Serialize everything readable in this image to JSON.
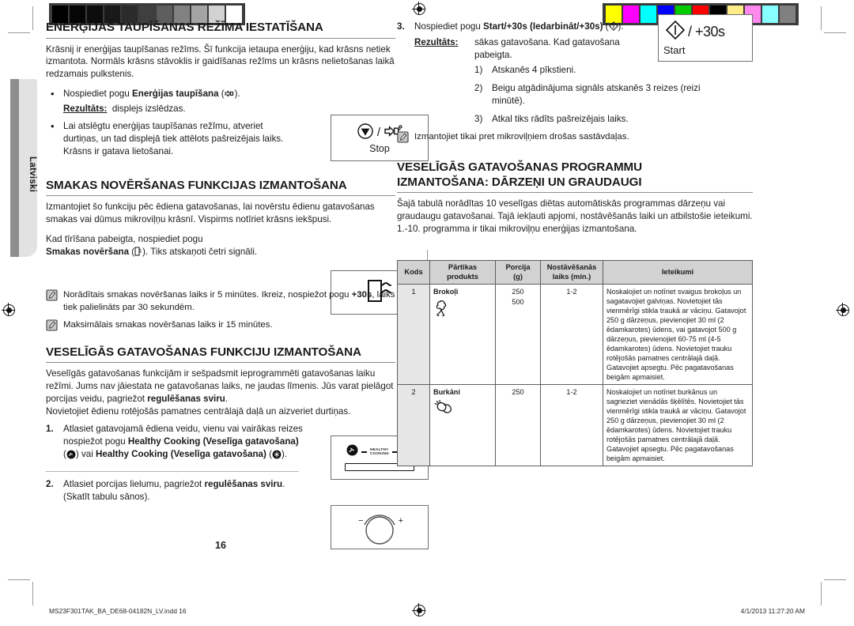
{
  "page": {
    "language_tab": "Latviski",
    "page_number": "16"
  },
  "calibration": {
    "gray_bar_name": "grayscale-calibration-bar",
    "gray_swatches": [
      "#000000",
      "#060606",
      "#0d0d0d",
      "#191919",
      "#2b2b2b",
      "#3f3f3f",
      "#5e5e5e",
      "#828282",
      "#a4a4a4",
      "#d2d2d2",
      "#ffffff"
    ],
    "color_bar_name": "color-calibration-bar",
    "color_swatches": [
      "#ffff00",
      "#ff00ff",
      "#00ffff",
      "#0000ff",
      "#00cc00",
      "#ff0000",
      "#000000",
      "#ffee88",
      "#ff88ee",
      "#88ffff",
      "#808080"
    ]
  },
  "left_column": {
    "section1": {
      "heading": "ENERĢIJAS TAUPĪŠANAS REŽĪMA IESTATĪŠANA",
      "intro": "Krāsnij ir enerģijas taupīšanas režīms. Šī funkcija ietaupa enerģiju, kad krāsns netiek izmantota. Normāls krāsns stāvoklis ir gaidīšanas režīms un krāsns nelietošanas laikā redzamais pulkstenis.",
      "bullet1_pre": "Nospiediet pogu ",
      "bullet1_bold": "Enerģijas taupīšana",
      "bullet1_post": " (",
      "bullet1_end": ").",
      "result_label": "Rezultāts:",
      "result_text": "displejs izslēdzas.",
      "bullet2": "Lai atslēgtu enerģijas taupīšanas režīmu, atveriet durtiņas, un tad displejā tiek attēlots pašreizējais laiks. Krāsns ir gatava lietošanai.",
      "illustration_label": "Stop"
    },
    "section2": {
      "heading": "SMAKAS NOVĒRŠANAS FUNKCIJAS IZMANTOŠANA",
      "intro": "Izmantojiet šo funkciju pēc ēdiena gatavošanas, lai novērstu ēdienu gatavošanas smakas vai dūmus mikroviļņu krāsnī. Vispirms notīriet krāsns iekšpusi.",
      "para2_line1": "Kad tīrīšana pabeigta, nospiediet pogu",
      "para2_bold": "Smakas novēršana",
      "para2_post": " (",
      "para2_end": "). Tiks atskaņoti četri signāli.",
      "note1_pre": "Norādītais smakas novēršanas laiks ir 5 minūtes. Ikreiz, nospiežot pogu ",
      "note1_bold": "+30s",
      "note1_post": ", laiks tiek palielināts par 30 sekundēm.",
      "note2": "Maksimālais smakas novēršanas laiks ir 15 minūtes."
    },
    "section3": {
      "heading": "VESELĪGĀS GATAVOŠANAS FUNKCIJU IZMANTOŠANA",
      "intro_l1": "Veselīgās gatavošanas funkcijām ir sešpadsmit ieprogrammēti gatavošanas laiku režīmi. Jums nav jāiestata ne gatavošanas laiks, ne jaudas līmenis. Jūs varat pielāgot porcijas veidu, pagriežot ",
      "intro_bold": "regulēšanas sviru",
      "intro_l2": ".",
      "intro_l3": "Novietojiet ēdienu rotējošās pamatnes centrālajā daļā un aizveriet durtiņas.",
      "step1_num": "1.",
      "step1_a": "Atlasiet gatavojamā ēdiena veidu, vienu vai vairākas reizes nospiežot pogu ",
      "step1_b1": "Healthy Cooking (Veselīga gatavošana)",
      "step1_mid": " vai ",
      "step1_b2": "Healthy Cooking (Veselīga gatavošana)",
      "step1_end": ".",
      "step1_illus_label_1": "HEALTHY",
      "step1_illus_label_2": "COOKING",
      "step2_num": "2.",
      "step2_a": "Atlasiet porcijas lielumu, pagriežot ",
      "step2_bold": "regulēšanas sviru",
      "step2_end": ". (Skatīt tabulu sānos).",
      "knob_minus": "−",
      "knob_plus": "+"
    }
  },
  "right_column": {
    "step3": {
      "num": "3.",
      "text_pre": "Nospiediet pogu ",
      "text_bold": "Start/+30s (Iedarbināt/+30s)",
      "text_post": " (",
      "text_end": ").",
      "result_label": "Rezultāts:",
      "result_text": "sākas gatavošana. Kad gatavošana pabeigta.",
      "sub_items": [
        "Atskanēs 4 pīkstieni.",
        "Beigu atgādinājuma signāls atskanēs 3 reizes (reizi minūtē).",
        "Atkal tiks rādīts pašreizējais laiks."
      ],
      "sub_markers": [
        "1)",
        "2)",
        "3)"
      ],
      "note": "Izmantojiet tikai pret mikroviļņiem drošas sastāvdaļas.",
      "illustration_plus": "/ +30s",
      "illustration_label": "Start"
    },
    "section_table": {
      "heading_l1": "VESELĪGĀS GATAVOŠANAS PROGRAMMU",
      "heading_l2": "IZMANTOŠANA: DĀRZEŅI UN GRAUDAUGI",
      "intro": "Šajā tabulā norādītas 10 veselīgas diētas automātiskās programmas dārzeņu vai graudaugu gatavošanai. Tajā iekļauti apjomi, nostāvēšanās laiki un atbilstošie ieteikumi. 1.-10. programma ir tikai mikroviļņu enerģijas izmantošana."
    },
    "table": {
      "headers": [
        {
          "l1": "Kods",
          "l2": ""
        },
        {
          "l1": "Pārtikas",
          "l2": "produkts"
        },
        {
          "l1": "Porcija",
          "l2": "(g)"
        },
        {
          "l1": "Nostāvēšanās",
          "l2": "laiks (min.)"
        },
        {
          "l1": "Ieteikumi",
          "l2": ""
        }
      ],
      "rows": [
        {
          "code": "1",
          "food": "Brokoļi",
          "icon": "broccoli-icon",
          "portion": [
            "250",
            "500"
          ],
          "standing": "1-2",
          "tip": "Noskalojiet un notīriet svaigus brokoļus un sagatavojiet galviņas. Novietojiet tās vienmērīgi stikla traukā ar vāciņu. Gatavojot 250 g dārzeņus, pievienojiet 30 ml (2 ēdamkarotes) ūdens, vai gatavojot 500 g dārzeņus, pievienojiet 60-75 ml (4-5 ēdamkarotes) ūdens. Novietojiet trauku rotējošās pamatnes centrālajā daļā. Gatavojiet apsegtu. Pēc pagatavošanas beigām apmaisiet."
        },
        {
          "code": "2",
          "food": "Burkāni",
          "icon": "carrot-icon",
          "portion": [
            "250"
          ],
          "standing": "1-2",
          "tip": "Noskalojiet un notīriet burkānus un sagrieziet vienādās šķēlītēs. Novietojiet tās vienmērīgi stikla traukā ar vāciņu. Gatavojot 250 g dārzeņus, pievienojiet 30 ml (2 ēdamkarotes) ūdens. Novietojiet trauku rotējošās pamatnes centrālajā daļā. Gatavojiet apsegtu. Pēc pagatavošanas beigām apmaisiet."
        }
      ]
    }
  },
  "footer": {
    "file": "MS23F301TAK_BA_DE68-04182N_LV.indd   16",
    "date": "4/1/2013   11:27:20 AM"
  }
}
